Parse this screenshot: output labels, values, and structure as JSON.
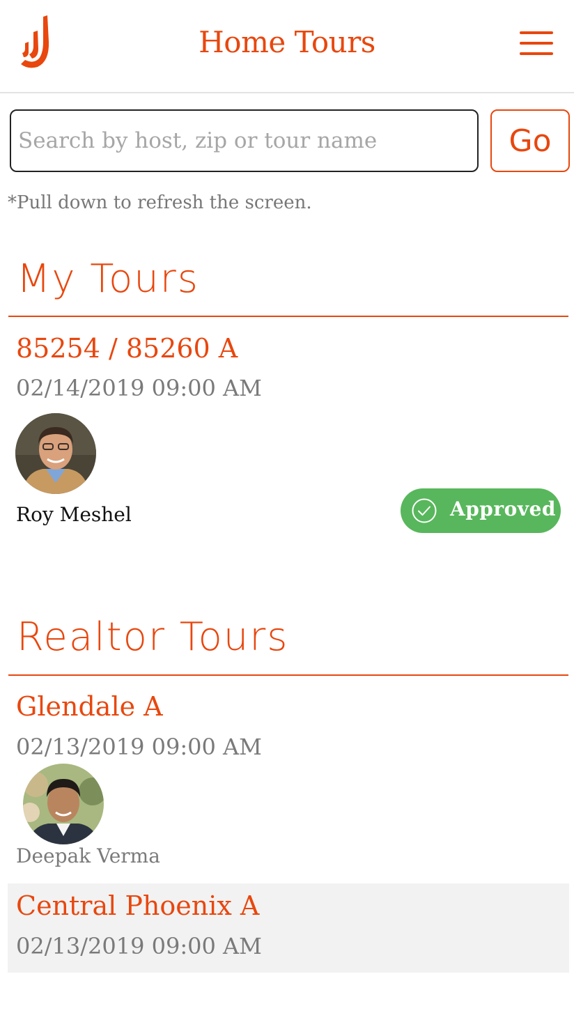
{
  "header": {
    "title": "Home Tours",
    "logo_icon": "j-logo-icon",
    "menu_icon": "hamburger-menu-icon"
  },
  "search": {
    "placeholder": "Search by host, zip or tour name",
    "value": "",
    "go_label": "Go"
  },
  "hint": "*Pull down to refresh the screen.",
  "my_tours": {
    "title": "My Tours",
    "items": [
      {
        "name": "85254 / 85260 A",
        "date": "02/14/2019 09:00 AM",
        "host": "Roy Meshel",
        "status": "Approved"
      }
    ]
  },
  "realtor_tours": {
    "title": "Realtor Tours",
    "items": [
      {
        "name": "Glendale A",
        "date": "02/13/2019 09:00 AM",
        "host": "Deepak Verma"
      },
      {
        "name": "Central Phoenix A",
        "date": "02/13/2019 09:00 AM"
      }
    ]
  },
  "colors": {
    "accent": "#e8470e",
    "approved": "#58b75c",
    "muted_text": "#7a7a7a"
  }
}
